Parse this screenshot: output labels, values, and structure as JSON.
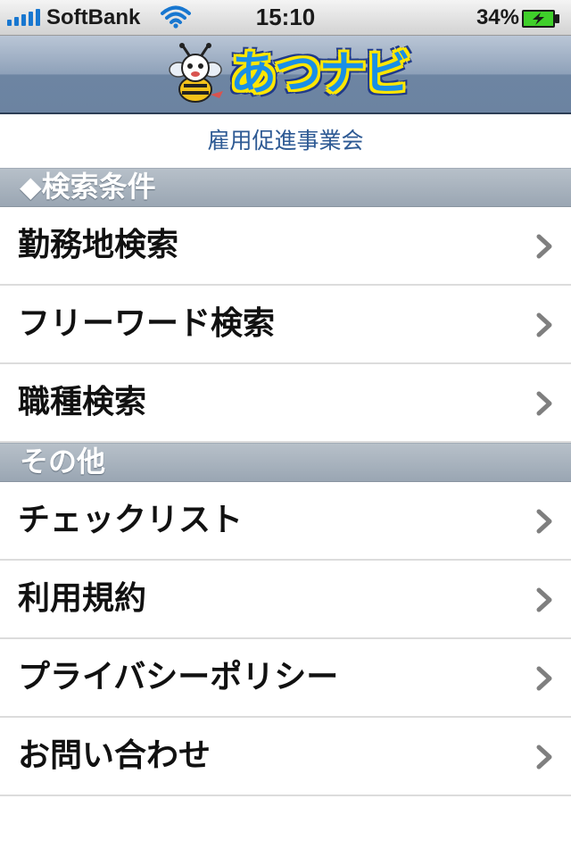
{
  "status_bar": {
    "carrier": "SoftBank",
    "time": "15:10",
    "battery_percent": "34%",
    "signal_icon": "signal-bars-icon",
    "wifi_icon": "wifi-icon",
    "battery_icon": "battery-charging-icon"
  },
  "header": {
    "logo_text": "あつナビ",
    "logo_icon": "bee-mascot-icon",
    "subtitle": "雇用促進事業会"
  },
  "sections": [
    {
      "title": "◆検索条件",
      "items": [
        {
          "label": "勤務地検索",
          "icon": "chevron-right-icon"
        },
        {
          "label": "フリーワード検索",
          "icon": "chevron-right-icon"
        },
        {
          "label": "職種検索",
          "icon": "chevron-right-icon"
        }
      ]
    },
    {
      "title": "その他",
      "items": [
        {
          "label": "チェックリスト",
          "icon": "chevron-right-icon"
        },
        {
          "label": "利用規約",
          "icon": "chevron-right-icon"
        },
        {
          "label": "プライバシーポリシー",
          "icon": "chevron-right-icon"
        },
        {
          "label": "お問い合わせ",
          "icon": "chevron-right-icon"
        }
      ]
    }
  ],
  "colors": {
    "signal_blue": "#1877d0",
    "subtitle_blue": "#2e5a94",
    "logo_blue": "#1a8fe6",
    "logo_yellow": "#ffe600",
    "battery_green": "#3fcf2a"
  }
}
